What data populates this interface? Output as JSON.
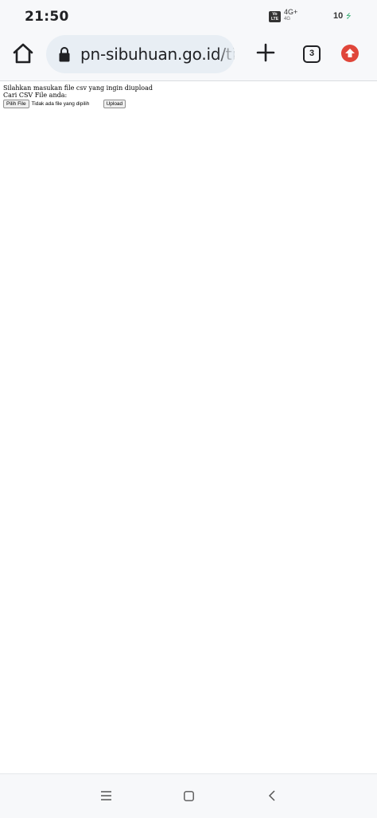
{
  "status_bar": {
    "time": "21:50",
    "volte_label": "Vo LTE",
    "network": "4G+",
    "network_sub": "4G",
    "battery": "10"
  },
  "toolbar": {
    "url": "pn-sibuhuan.go.id/tila",
    "tab_count": "3"
  },
  "page": {
    "instruction": "Silahkan masukan file csv yang ingin diupload",
    "prompt": "Cari CSV File anda:",
    "choose_file_label": "Pilih File",
    "file_status": "Tidak ada file yang dipilih",
    "upload_label": "Upload"
  },
  "colors": {
    "chrome_bg": "#f7f8fa",
    "url_bg": "#e8eef4",
    "update_red": "#e0463a"
  },
  "icons": {
    "home": "home-icon",
    "lock": "lock-icon",
    "plus": "plus-icon",
    "update": "arrow-up-icon",
    "nav_menu": "menu-icon",
    "nav_home": "square-icon",
    "nav_back": "chevron-left-icon"
  }
}
